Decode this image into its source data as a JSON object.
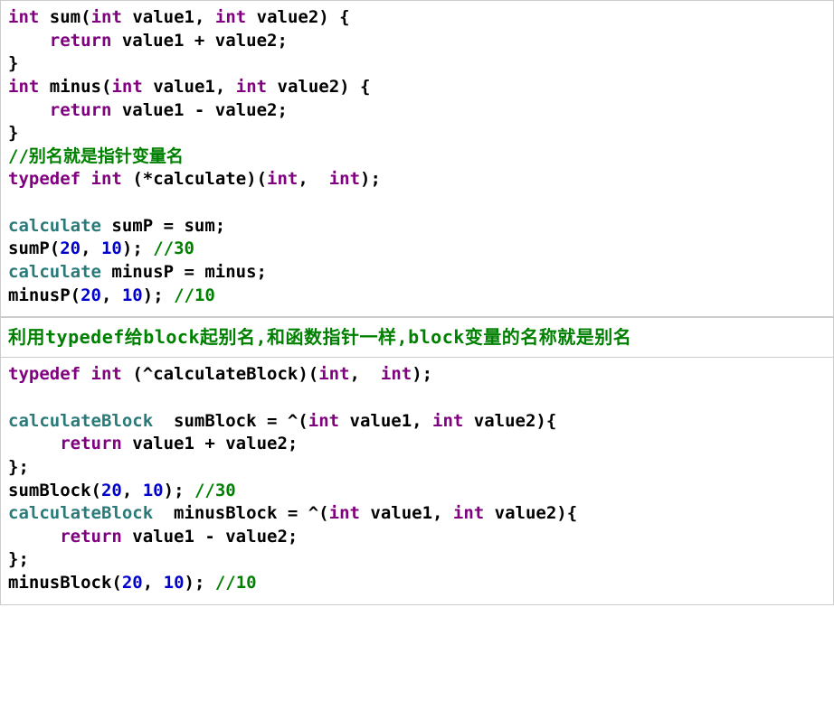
{
  "block1": {
    "l1_int1": "int",
    "l1_sum": "sum",
    "l1_int2": "int",
    "l1_v1": "value1",
    "l1_int3": "int",
    "l1_v2": "value2",
    "l2_ret": "return",
    "l2_expr": "value1 + value2;",
    "l3_brace": "}",
    "l4_int1": "int",
    "l4_minus": "minus",
    "l4_int2": "int",
    "l4_v1": "value1",
    "l4_int3": "int",
    "l4_v2": "value2",
    "l5_ret": "return",
    "l5_expr": "value1 - value2;",
    "l6_brace": "}",
    "l7_cmt": "//别名就是指针变量名",
    "l8_td": "typedef",
    "l8_int1": "int",
    "l8_calc": "(*calculate)(",
    "l8_int2": "int",
    "l8_comma": ",  ",
    "l8_int3": "int",
    "l8_close": ");",
    "l9_type": "calculate",
    "l9_rest": " sumP = sum;",
    "l10_a": "sumP(",
    "l10_n1": "20",
    "l10_b": ", ",
    "l10_n2": "10",
    "l10_c": "); ",
    "l10_cmt": "//30",
    "l11_type": "calculate",
    "l11_rest": " minusP = minus;",
    "l12_a": "minusP(",
    "l12_n1": "20",
    "l12_b": ", ",
    "l12_n2": "10",
    "l12_c": "); ",
    "l12_cmt": "//10"
  },
  "heading": "利用typedef给block起别名,和函数指针一样,block变量的名称就是别名",
  "block2": {
    "l1_td": "typedef",
    "l1_int1": "int",
    "l1_calc": "(^calculateBlock)(",
    "l1_int2": "int",
    "l1_comma": ",  ",
    "l1_int3": "int",
    "l1_close": ");",
    "l2_type": "calculateBlock",
    "l2_a": "  sumBlock = ^(",
    "l2_int1": "int",
    "l2_b": " value1, ",
    "l2_int2": "int",
    "l2_c": " value2){",
    "l3_ret": "return",
    "l3_expr": "value1 + value2;",
    "l4_brace": "};",
    "l5_a": "sumBlock(",
    "l5_n1": "20",
    "l5_b": ", ",
    "l5_n2": "10",
    "l5_c": "); ",
    "l5_cmt": "//30",
    "l6_type": "calculateBlock",
    "l6_a": "  minusBlock = ^(",
    "l6_int1": "int",
    "l6_b": " value1, ",
    "l6_int2": "int",
    "l6_c": " value2){",
    "l7_ret": "return",
    "l7_expr": "value1 - value2;",
    "l8_brace": "};",
    "l9_a": "minusBlock(",
    "l9_n1": "20",
    "l9_b": ", ",
    "l9_n2": "10",
    "l9_c": "); ",
    "l9_cmt": "//10"
  }
}
